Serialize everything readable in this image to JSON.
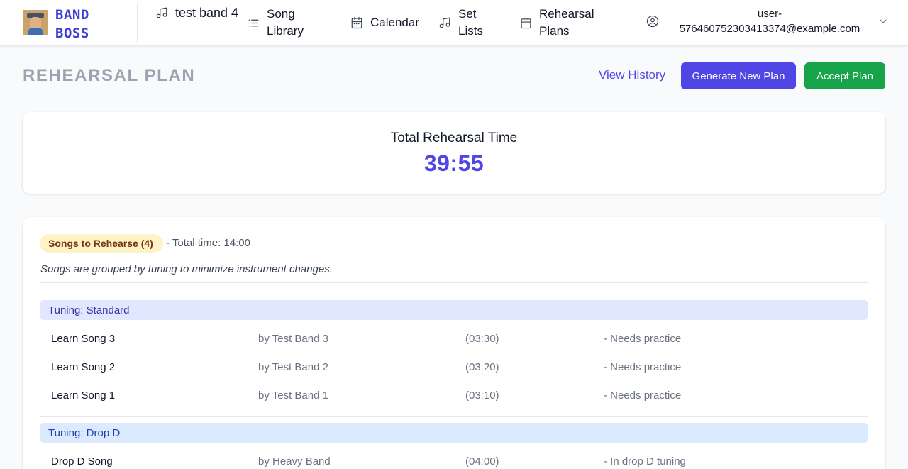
{
  "brand": {
    "line1": "BAND",
    "line2": "BOSS",
    "color": "#3f3fd6"
  },
  "nav": {
    "band_name": "test band 4",
    "song_library": "Song Library",
    "calendar": "Calendar",
    "set_lists": "Set Lists",
    "rehearsal_plans": "Rehearsal Plans",
    "user_email": "user-576460752303413374@example.com"
  },
  "header": {
    "title": "REHEARSAL PLAN",
    "view_history": "View History",
    "generate_new_plan": "Generate New Plan",
    "accept_plan": "Accept Plan"
  },
  "total": {
    "label": "Total Rehearsal Time",
    "value": "39:55"
  },
  "songs_section": {
    "pill": "Songs to Rehearse (4)",
    "total_time": "- Total time: 14:00",
    "note": "Songs are grouped by tuning to minimize instrument changes.",
    "groups": [
      {
        "label": "Tuning: Standard",
        "songs": [
          {
            "title": "Learn Song 3",
            "artist": "by Test Band 3",
            "duration": "(03:30)",
            "note": "- Needs practice"
          },
          {
            "title": "Learn Song 2",
            "artist": "by Test Band 2",
            "duration": "(03:20)",
            "note": "- Needs practice"
          },
          {
            "title": "Learn Song 1",
            "artist": "by Test Band 1",
            "duration": "(03:10)",
            "note": "- Needs practice"
          }
        ]
      },
      {
        "label": "Tuning: Drop D",
        "songs": [
          {
            "title": "Drop D Song",
            "artist": "by Heavy Band",
            "duration": "(04:00)",
            "note": "- In drop D tuning"
          }
        ]
      }
    ]
  },
  "colors": {
    "accent": "#4f46e5",
    "accept": "#16a34a",
    "pill_bg": "#fef3c7",
    "standard_bg": "#e0e7ff",
    "dropd_bg": "#dbeafe"
  },
  "icons": {
    "band": "music-note-icon",
    "song_library": "list-icon",
    "calendar": "calendar-icon",
    "set_lists": "music-note-icon",
    "rehearsal_plans": "calendar-icon",
    "user": "user-circle-icon",
    "dropdown": "chevron-down-icon"
  }
}
